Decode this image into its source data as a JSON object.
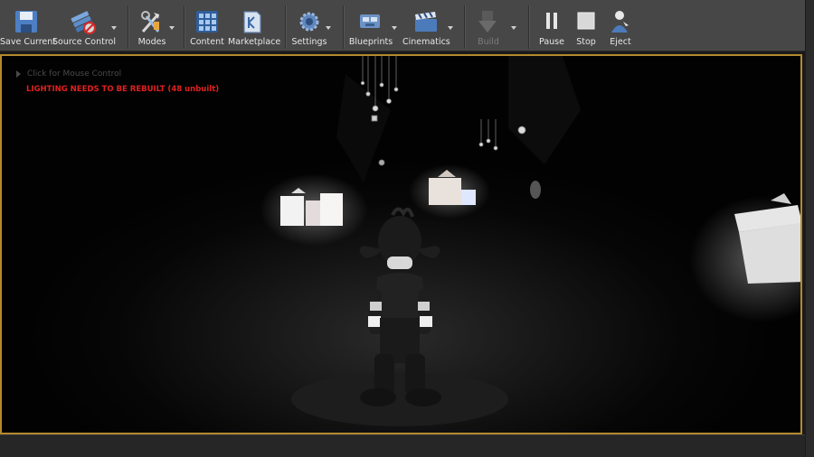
{
  "toolbar": {
    "save_current": "Save Current",
    "source_control": "Source Control",
    "modes": "Modes",
    "content": "Content",
    "marketplace": "Marketplace",
    "settings": "Settings",
    "blueprints": "Blueprints",
    "cinematics": "Cinematics",
    "build": "Build",
    "pause": "Pause",
    "stop": "Stop",
    "eject": "Eject"
  },
  "viewport": {
    "mouse_control_hint": "Click for Mouse Control",
    "lighting_warning": "LIGHTING NEEDS TO BE REBUILT (48 unbuilt)"
  },
  "colors": {
    "toolbar_bg": "#474747",
    "viewport_border": "#b38a2e",
    "warning": "#e02020"
  }
}
